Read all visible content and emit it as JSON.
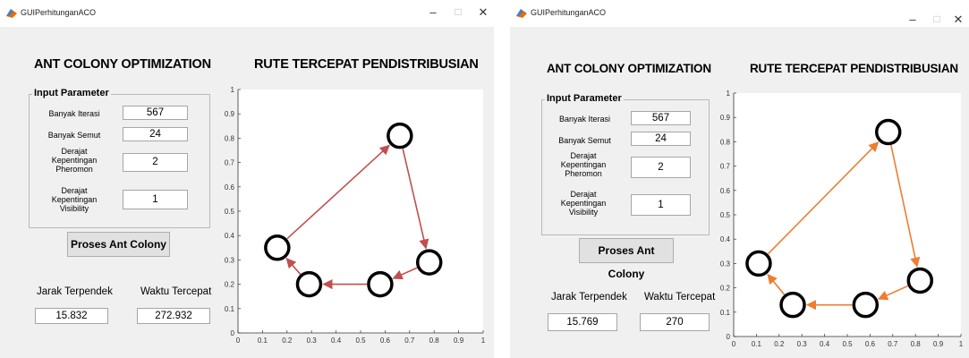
{
  "windows": [
    {
      "window_title": "GUIPerhitunganACO",
      "title_buttons": {
        "minimize": "–",
        "maximize": "□",
        "close": "✕"
      },
      "title_aco": "ANT COLONY OPTIMIZATION",
      "title_route": "RUTE TERCEPAT PENDISTRIBUSIAN",
      "panel_title": "Input Parameter",
      "params": [
        {
          "label": "Banyak Iterasi",
          "value": "567"
        },
        {
          "label": "Banyak Semut",
          "value": "24"
        },
        {
          "label": "Derajat Kepentingan Pheromon",
          "value": "2"
        },
        {
          "label": "Derajat Kepentingan Visibility",
          "value": "1"
        }
      ],
      "process_button": "Proses Ant Colony",
      "result_labels": {
        "distance": "Jarak Terpendek",
        "time": "Waktu Tercepat"
      },
      "results": {
        "distance": "15.832",
        "time": "272.932"
      },
      "arrow_color": "#c0504d",
      "chart_data": {
        "type": "scatter",
        "title": "RUTE TERCEPAT PENDISTRIBUSIAN",
        "xlim": [
          0,
          1
        ],
        "ylim": [
          0,
          1
        ],
        "xticks": [
          "0",
          "0.1",
          "0.2",
          "0.3",
          "0.4",
          "0.5",
          "0.6",
          "0.7",
          "0.8",
          "0.9",
          "1"
        ],
        "yticks": [
          "0",
          "0.1",
          "0.2",
          "0.3",
          "0.4",
          "0.5",
          "0.6",
          "0.7",
          "0.8",
          "0.9",
          "1"
        ],
        "points": [
          {
            "x": 0.16,
            "y": 0.35
          },
          {
            "x": 0.66,
            "y": 0.81
          },
          {
            "x": 0.78,
            "y": 0.29
          },
          {
            "x": 0.58,
            "y": 0.2
          },
          {
            "x": 0.29,
            "y": 0.2
          }
        ],
        "route": [
          [
            0,
            1
          ],
          [
            1,
            2
          ],
          [
            2,
            3
          ],
          [
            3,
            4
          ],
          [
            4,
            0
          ]
        ]
      }
    },
    {
      "window_title": "GUIPerhitunganACO",
      "title_buttons": {
        "minimize": "–",
        "maximize": "□",
        "close": "✕"
      },
      "title_aco": "ANT COLONY OPTIMIZATION",
      "title_route": "RUTE TERCEPAT PENDISTRIBUSIAN",
      "panel_title": "Input Parameter",
      "params": [
        {
          "label": "Banyak Iterasi",
          "value": "567"
        },
        {
          "label": "Banyak Semut",
          "value": "24"
        },
        {
          "label": "Derajat Kepentingan Pheromon",
          "value": "2"
        },
        {
          "label": "Derajat Kepentingan Visibility",
          "value": "1"
        }
      ],
      "process_button": "Proses Ant Colony",
      "result_labels": {
        "distance": "Jarak Terpendek",
        "time": "Waktu Tercepat"
      },
      "results": {
        "distance": "15.769",
        "time": "270"
      },
      "arrow_color": "#ed7d31",
      "chart_data": {
        "type": "scatter",
        "title": "RUTE TERCEPAT PENDISTRIBUSIAN",
        "xlim": [
          0,
          1
        ],
        "ylim": [
          0,
          1
        ],
        "xticks": [
          "0",
          "0.1",
          "0.2",
          "0.3",
          "0.4",
          "0.5",
          "0.6",
          "0.7",
          "0.8",
          "0.9",
          "1"
        ],
        "yticks": [
          "0",
          "0.1",
          "0.2",
          "0.3",
          "0.4",
          "0.5",
          "0.6",
          "0.7",
          "0.8",
          "0.9",
          "1"
        ],
        "points": [
          {
            "x": 0.11,
            "y": 0.3
          },
          {
            "x": 0.68,
            "y": 0.84
          },
          {
            "x": 0.82,
            "y": 0.23
          },
          {
            "x": 0.58,
            "y": 0.13
          },
          {
            "x": 0.26,
            "y": 0.13
          }
        ],
        "route": [
          [
            0,
            1
          ],
          [
            1,
            2
          ],
          [
            2,
            3
          ],
          [
            3,
            4
          ],
          [
            4,
            0
          ]
        ]
      }
    }
  ]
}
